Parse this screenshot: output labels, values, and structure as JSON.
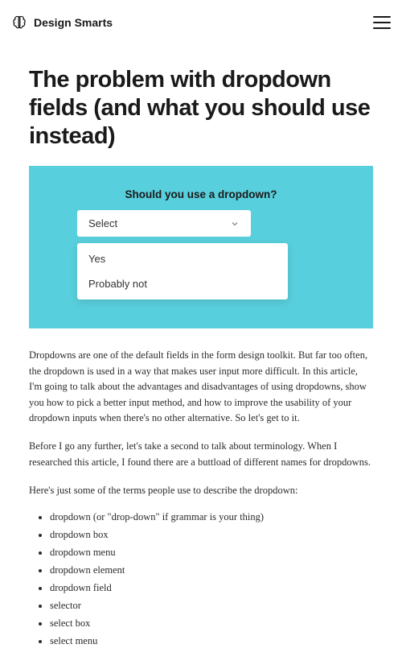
{
  "header": {
    "brand": "Design Smarts"
  },
  "article": {
    "title": "The problem with dropdown fields (and what you should use instead)",
    "hero": {
      "question": "Should you use a dropdown?",
      "select_placeholder": "Select",
      "options": [
        "Yes",
        "Probably not"
      ]
    },
    "paragraphs": [
      "Dropdowns are one of the default fields in the form design toolkit. But far too often, the dropdown is used in a way that makes user input more difficult. In this article, I'm going to talk about the advantages and disadvantages of using dropdowns, show you how to pick a better input method, and how to improve the usability of your dropdown inputs when there's no other alternative. So let's get to it.",
      "Before I go any further, let's take a second to talk about terminology. When I researched this article, I found there are a buttload of different names for dropdowns.",
      "Here's just some of the terms people use to describe the dropdown:"
    ],
    "terms": [
      "dropdown (or \"drop-down\" if grammar is your thing)",
      "dropdown box",
      "dropdown menu",
      "dropdown element",
      "dropdown field",
      "selector",
      "select box",
      "select menu"
    ]
  }
}
